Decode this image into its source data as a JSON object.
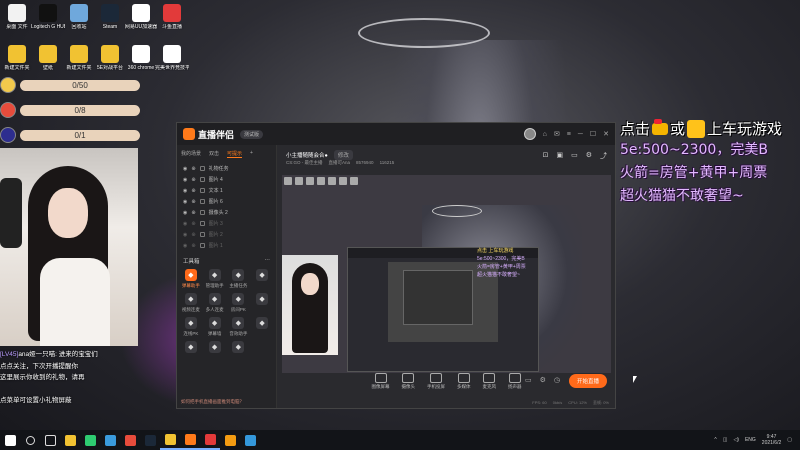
{
  "desktop": {
    "icons_row1": [
      {
        "label": "桌面 文件",
        "icon": "file-icon",
        "color": "#f2f2f2"
      },
      {
        "label": "Logitech G HUB",
        "icon": "logitech-g-icon",
        "color": "#111111"
      },
      {
        "label": "回收站",
        "icon": "recycle-bin-icon",
        "color": "#6fa8dc"
      },
      {
        "label": "Steam",
        "icon": "steam-icon",
        "color": "#1b2838"
      },
      {
        "label": "网易UU加速器",
        "icon": "uu-accelerator-icon",
        "color": "#ffffff"
      },
      {
        "label": "斗鱼直播",
        "icon": "app-icon",
        "color": "#e23a3a"
      }
    ],
    "icons_row2": [
      {
        "label": "新建文件夹",
        "icon": "folder-icon",
        "color": "#f1c232"
      },
      {
        "label": "壁纸",
        "icon": "folder-icon",
        "color": "#f1c232"
      },
      {
        "label": "新建文件夹",
        "icon": "folder-icon",
        "color": "#f1c232"
      },
      {
        "label": "5E对战平台",
        "icon": "5e-platform-icon",
        "color": "#f1c232"
      },
      {
        "label": "360 chrome",
        "icon": "document-icon",
        "color": "#ffffff"
      },
      {
        "label": "完美世界竞技平台",
        "icon": "perfect-world-icon",
        "color": "#ffffff"
      }
    ]
  },
  "progress": [
    {
      "label": "0/50",
      "fraction": 0.0,
      "badge_color": "#f2c94c"
    },
    {
      "label": "0/8",
      "fraction": 0.0,
      "badge_color": "#e74c3c"
    },
    {
      "label": "0/1",
      "fraction": 0.0,
      "badge_color": "#2d2d8f"
    }
  ],
  "chat": {
    "lines": [
      {
        "prefix": "[LV45]",
        "text": "ana娅一只喵: 进来的宝宝们"
      },
      {
        "prefix": "",
        "text": "点点关注，下次开播提醒你"
      },
      {
        "prefix": "",
        "text": "这里展示你收到的礼物，请再"
      },
      {
        "prefix": "",
        "text": ""
      },
      {
        "prefix": "",
        "text": "点菜单可设置小礼物屏蔽"
      }
    ]
  },
  "app": {
    "name": "直播伴侣",
    "version": "测试版",
    "sidebar": {
      "tabs": [
        "我的场景",
        "双击",
        "可提示"
      ],
      "sources": [
        {
          "label": "礼物任务",
          "dim": false
        },
        {
          "label": "图片 4",
          "dim": false
        },
        {
          "label": "文本 1",
          "dim": false
        },
        {
          "label": "图片 6",
          "dim": false
        },
        {
          "label": "摄像头 2",
          "dim": false
        },
        {
          "label": "图片 3",
          "dim": true
        },
        {
          "label": "图片 2",
          "dim": true
        },
        {
          "label": "图片 1",
          "dim": true
        }
      ],
      "tools_header": "工具箱",
      "tools": [
        {
          "label": "弹幕助手",
          "icon": "gift-icon",
          "hot": true
        },
        {
          "label": "管理助手",
          "icon": "mic-icon",
          "hot": false
        },
        {
          "label": "主播任务",
          "icon": "tasks-icon",
          "hot": false
        },
        {
          "label": "",
          "icon": "empty-icon",
          "hot": false
        },
        {
          "label": "视频连麦",
          "icon": "video-icon",
          "hot": false
        },
        {
          "label": "多人连麦",
          "icon": "users-icon",
          "hot": false
        },
        {
          "label": "房间PK",
          "icon": "pk-icon",
          "hot": false
        },
        {
          "label": "",
          "icon": "empty-icon",
          "hot": false
        },
        {
          "label": "连线PK",
          "icon": "link-icon",
          "hot": false
        },
        {
          "label": "弹幕墙",
          "icon": "danmu-icon",
          "hot": false
        },
        {
          "label": "音效助手",
          "icon": "sound-icon",
          "hot": false
        },
        {
          "label": "",
          "icon": "empty-icon",
          "hot": false
        },
        {
          "label": "",
          "icon": "empty-icon",
          "hot": false
        },
        {
          "label": "",
          "icon": "empty-icon",
          "hot": false
        },
        {
          "label": "",
          "icon": "empty-icon",
          "hot": false
        }
      ],
      "footer": "如何把手机直播画面推到电脑？"
    },
    "stream": {
      "title": "小主播随随会合●",
      "edit_label": "修改",
      "category": "CS:GO - 最佳主播",
      "room_label": "直播可Ana",
      "viewers": "8576940",
      "fans": "116215"
    },
    "overlay": {
      "line1": "点击",
      "line1b": "上车玩游戏",
      "line2": "5e:500~2300，完美B",
      "line3": "火箭=房管+黄甲+周票",
      "line4": "超火猫猫不敢奢望~"
    },
    "dock": [
      {
        "label": "图像屏幕",
        "icon": "screen-icon"
      },
      {
        "label": "摄像头",
        "icon": "camera-icon"
      },
      {
        "label": "手机投屏",
        "icon": "phone-icon"
      },
      {
        "label": "多媒体",
        "icon": "media-icon"
      },
      {
        "label": "麦克风",
        "icon": "mic-icon"
      },
      {
        "label": "扬声器",
        "icon": "speaker-icon"
      }
    ],
    "live_button": "开始直播",
    "status": [
      "FPS: 60",
      "0kb/s",
      "CPU: 12%",
      "丢帧: 0%"
    ]
  },
  "right_overlay": {
    "line1a": "点击",
    "line1b": "或",
    "line1c": "上车玩游戏",
    "line2": "5e:500~2300，完美B",
    "line3": "火箭=房管+黄甲+周票",
    "line4": "超火猫猫不敢奢望~"
  },
  "taskbar": {
    "icons": [
      {
        "name": "windows-start-icon",
        "color": "#ffffff"
      },
      {
        "name": "search-icon",
        "color": "#dddddd"
      },
      {
        "name": "task-view-icon",
        "color": "#dddddd"
      },
      {
        "name": "file-explorer-icon",
        "color": "#f1c232"
      },
      {
        "name": "green-app-icon",
        "color": "#2ecc71"
      },
      {
        "name": "edge-icon",
        "color": "#3a9bdc"
      },
      {
        "name": "red-app-icon",
        "color": "#e74c3c"
      },
      {
        "name": "steam-icon",
        "color": "#1b2838"
      },
      {
        "name": "folder-icon",
        "color": "#f1c232"
      },
      {
        "name": "live-companion-icon",
        "color": "#ff7a1a"
      },
      {
        "name": "douyu-icon",
        "color": "#e23a3a"
      },
      {
        "name": "orange-app-icon",
        "color": "#f39c12"
      },
      {
        "name": "blue-app-icon",
        "color": "#3498db"
      }
    ],
    "tray_lang": "ENG",
    "time": "9:47",
    "date": "2021/6/2"
  }
}
